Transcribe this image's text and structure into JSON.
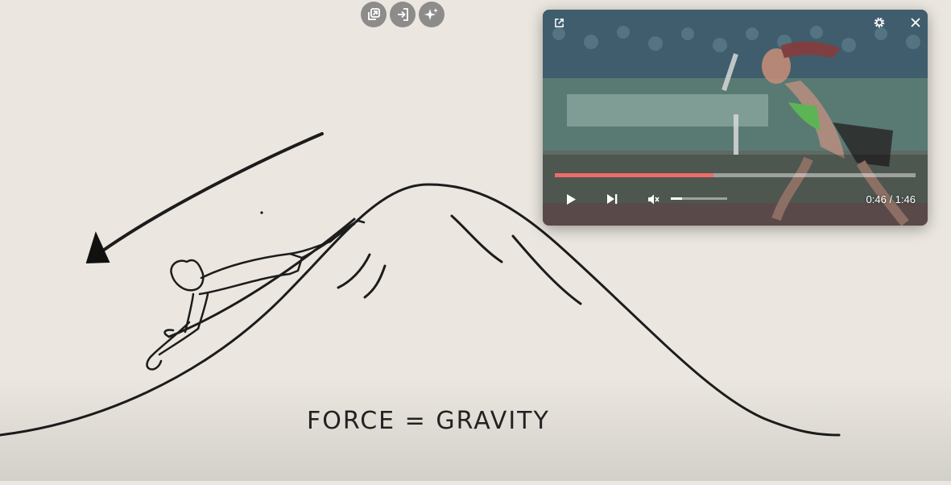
{
  "caption": "FORCE = GRAVITY",
  "toolbar": {
    "buttons": [
      {
        "icon": "copy-stack-icon"
      },
      {
        "icon": "sign-in-icon"
      },
      {
        "icon": "sparkles-icon"
      }
    ]
  },
  "pip": {
    "progress": 0.44,
    "volume": 0.2,
    "time": "0:46 / 1:46",
    "accent": "#ef6b6b"
  }
}
